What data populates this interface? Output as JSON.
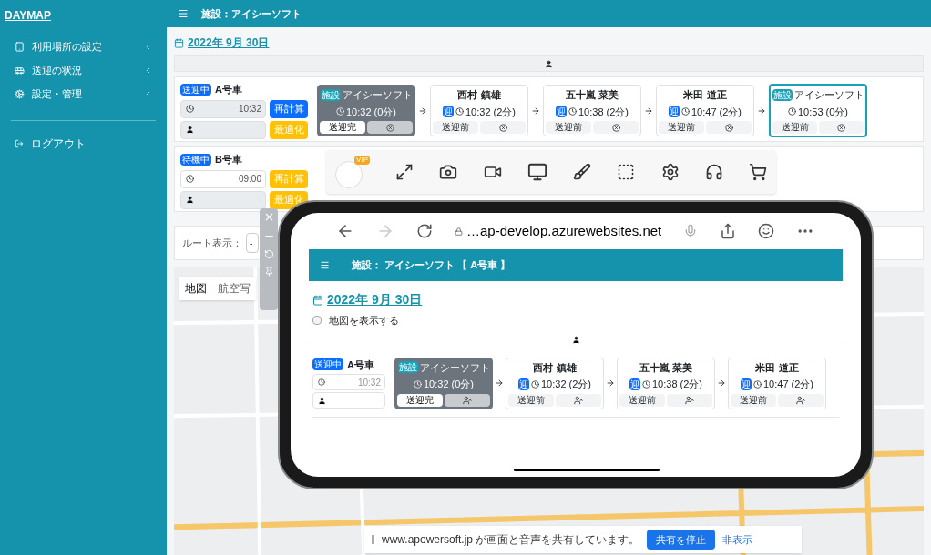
{
  "sidebar": {
    "logo": "DAYMAP",
    "items": [
      {
        "label": "利用場所の設定"
      },
      {
        "label": "送迎の状況"
      },
      {
        "label": "設定・管理"
      }
    ],
    "logout": "ログアウト"
  },
  "header": {
    "title": "施設：アイシーソフト"
  },
  "date": "2022年 9月 30日",
  "vehicles": [
    {
      "status": "送迎中",
      "name": "A号車",
      "time": "10:32",
      "time_locked": true,
      "recalc": "再計算",
      "recalc_highlighted": true,
      "optimize": "最適化",
      "stops": [
        {
          "kind": "facility",
          "badge": "施設",
          "name": "アイシーソフト",
          "time": "10:32 (0分)",
          "status": "送迎完",
          "done": true
        },
        {
          "kind": "pickup",
          "badge": "迎",
          "name": "西村 鎮雄",
          "time": "10:32 (2分)",
          "status": "送迎前",
          "done": false
        },
        {
          "kind": "pickup",
          "badge": "迎",
          "name": "五十嵐 菜美",
          "time": "10:38 (2分)",
          "status": "送迎前",
          "done": false
        },
        {
          "kind": "pickup",
          "badge": "迎",
          "name": "米田 道正",
          "time": "10:47 (2分)",
          "status": "送迎前",
          "done": false
        },
        {
          "kind": "facility",
          "badge": "施設",
          "name": "アイシーソフト",
          "time": "10:53 (0分)",
          "status": "送迎前",
          "done": false
        }
      ]
    },
    {
      "status": "待機中",
      "name": "B号車",
      "time": "09:00",
      "time_locked": false,
      "recalc": "再計算",
      "recalc_highlighted": false,
      "optimize": "最適化"
    }
  ],
  "route_display": {
    "label": "ルート表示：",
    "value": "-"
  },
  "map": {
    "tabs": [
      {
        "label": "地図",
        "selected": true
      },
      {
        "label": "航空写",
        "selected": false
      }
    ]
  },
  "recorder_toolbar": {
    "badge": "VIP"
  },
  "phone": {
    "url": "…ap-develop.azurewebsites.net",
    "header": "施設： アイシーソフト 【 A号車 】",
    "date": "2022年 9月 30日",
    "show_map": {
      "label": "地図を表示する",
      "checked": false
    },
    "vehicle": {
      "status": "送迎中",
      "name": "A号車",
      "time": "10:32",
      "stops": [
        {
          "kind": "facility",
          "badge": "施設",
          "name": "アイシーソフト",
          "time": "10:32 (0分)",
          "status": "送迎完",
          "done": true
        },
        {
          "kind": "pickup",
          "badge": "迎",
          "name": "西村 鎮雄",
          "time": "10:32 (2分)",
          "status": "送迎前",
          "done": false
        },
        {
          "kind": "pickup",
          "badge": "迎",
          "name": "五十嵐 菜美",
          "time": "10:38 (2分)",
          "status": "送迎前",
          "done": false
        },
        {
          "kind": "pickup",
          "badge": "迎",
          "name": "米田 道正",
          "time": "10:47 (2分)",
          "status": "送迎前",
          "done": false
        }
      ]
    }
  },
  "share_bar": {
    "message": "www.apowersoft.jp が画面と音声を共有しています。",
    "stop": "共有を停止",
    "hide": "非表示"
  }
}
